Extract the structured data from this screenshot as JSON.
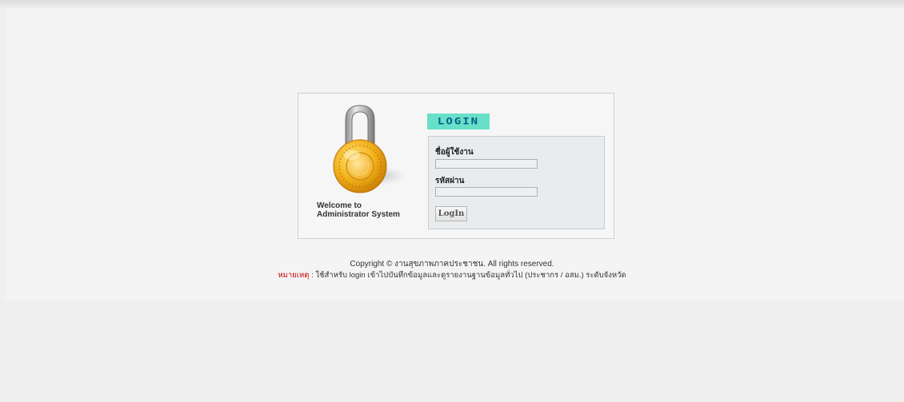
{
  "login_box": {
    "welcome_line1": "Welcome to",
    "welcome_line2": "Administrator System",
    "heading": "LOGIN",
    "username_label": "ชื่อผู้ใช้งาน",
    "username_value": "",
    "password_label": "รหัสผ่าน",
    "password_value": "",
    "login_button_label": "LogIn",
    "padlock_icon": "padlock-icon"
  },
  "footer": {
    "copyright": "Copyright © งานสุขภาพภาคประชาชน. All rights reserved.",
    "note_label": "หมายเหตุ",
    "note_separator": " : ",
    "note_text": "ใช้สำหรับ login เข้าไปบันทึกข้อมูลและดูรายงานฐานข้อมูลทั่วไป (ประชากร / อสม.) ระดับจังหวัด"
  },
  "colors": {
    "background": "#f0f0f0",
    "heading_highlight": "#67e0c8",
    "heading_text": "#0a5a8a",
    "note_label": "#cc0000",
    "lock_gold": "#f3b21a"
  }
}
